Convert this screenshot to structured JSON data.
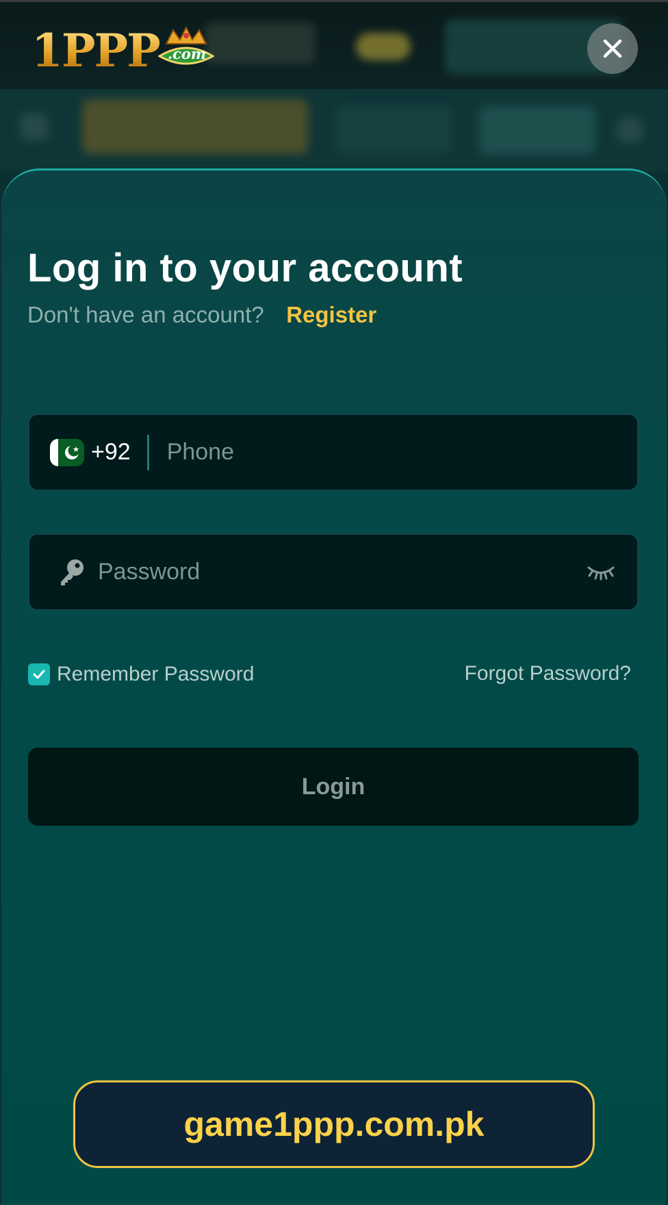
{
  "brand": {
    "logo_text": "1PPP",
    "emblem_text": ".com"
  },
  "login": {
    "title": "Log in to your account",
    "no_account_text": "Don't have an account?",
    "register_label": "Register",
    "phone": {
      "country_code": "+92",
      "placeholder": "Phone",
      "value": "",
      "flag_icon": "pakistan-flag-icon"
    },
    "password": {
      "placeholder": "Password",
      "value": "",
      "leading_icon": "key-icon",
      "toggle_icon": "eye-closed-icon"
    },
    "remember_label": "Remember Password",
    "remember_checked": true,
    "forgot_label": "Forgot Password?",
    "submit_label": "Login"
  },
  "watermark": {
    "text": "game1ppp.com.pk"
  },
  "colors": {
    "accent_teal": "#1ab7b0",
    "link_yellow": "#f2c443",
    "sheet_bg": "#004a46",
    "field_bg": "#011a1b",
    "watermark_border": "#f0c443"
  }
}
